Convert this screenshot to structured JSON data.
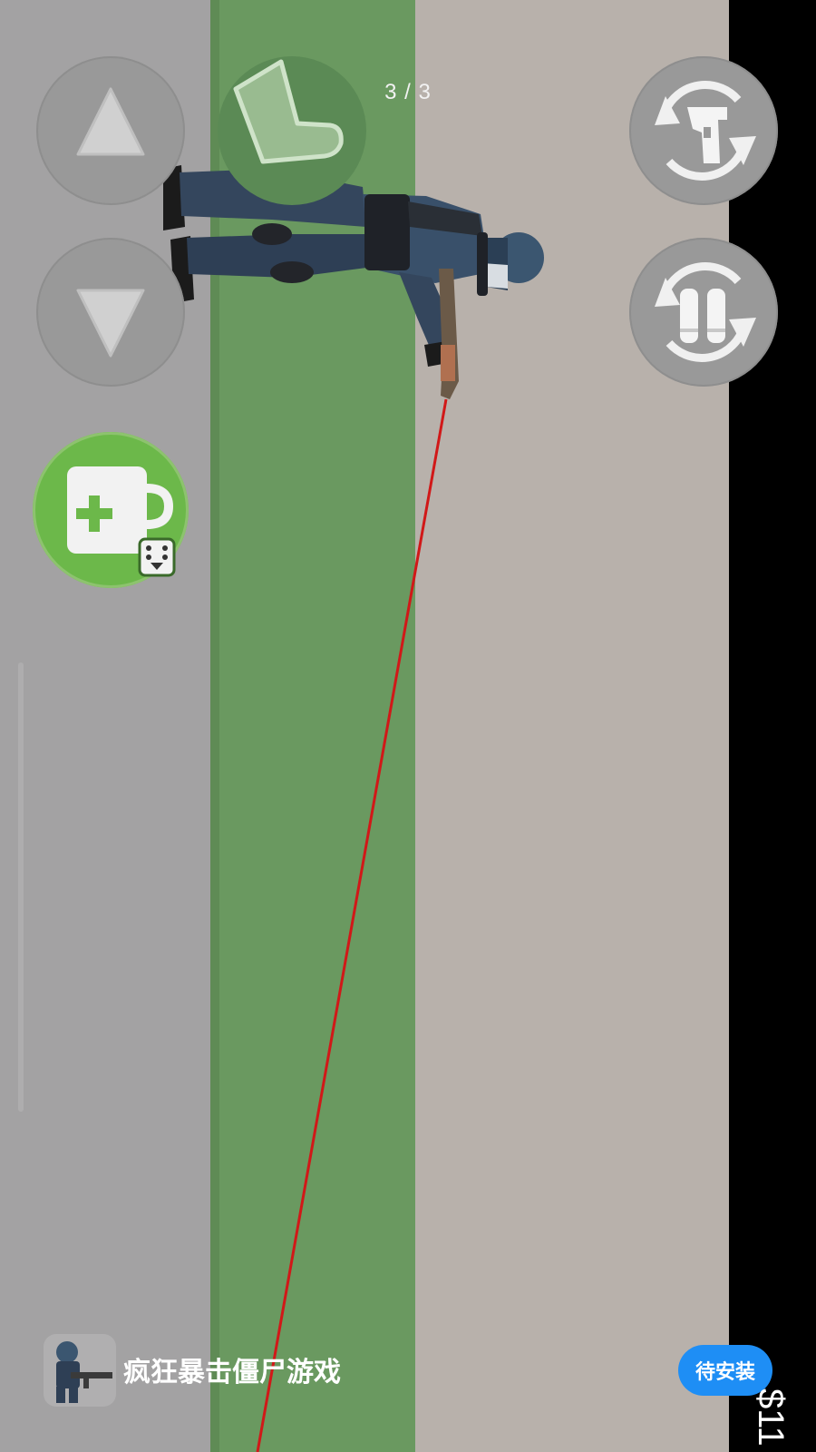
{
  "hud": {
    "page_indicator": "3 / 3",
    "money": "$11"
  },
  "controls": {
    "up_button": "up-arrow-icon",
    "down_button": "down-arrow-icon",
    "stance_button": "prone-stance-icon",
    "swap_weapon_button": "swap-weapon-icon",
    "swap_ammo_button": "swap-ammo-icon",
    "medkit_button": "medkit-icon",
    "back_button": "back-chevron-icon"
  },
  "banner": {
    "title": "疯狂暴击僵尸游戏",
    "install_label": "待安装"
  },
  "colors": {
    "grass": "#6a9960",
    "road": "#b8b1ab",
    "ground_left": "#a3a2a3",
    "laser": "#d11818",
    "medkit_green": "#6cb84a",
    "install_blue": "#1e8ef5"
  }
}
